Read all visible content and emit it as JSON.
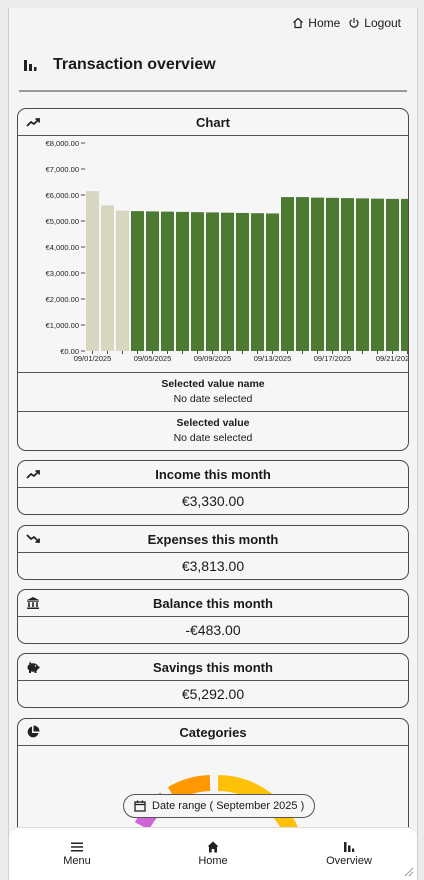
{
  "nav": {
    "home_label": "Home",
    "logout_label": "Logout"
  },
  "page": {
    "title": "Transaction overview"
  },
  "chart_card": {
    "title": "Chart",
    "selected_name_label": "Selected value name",
    "selected_name_value": "No date selected",
    "selected_value_label": "Selected value",
    "selected_value_value": "No date selected"
  },
  "chart_data": {
    "type": "bar",
    "ylim": [
      0,
      8000
    ],
    "yticks": [
      "€0.00",
      "€1,000.00",
      "€2,000.00",
      "€3,000.00",
      "€4,000.00",
      "€5,000.00",
      "€6,000.00",
      "€7,000.00",
      "€8,000.00"
    ],
    "x_tick_labels": [
      "09/01/2025",
      "09/05/2025",
      "09/09/2025",
      "09/13/2025",
      "09/17/2025",
      "09/21/202"
    ],
    "values": [
      6150,
      5600,
      5400,
      5380,
      5370,
      5360,
      5350,
      5340,
      5330,
      5320,
      5310,
      5300,
      5290,
      5920,
      5920,
      5900,
      5890,
      5880,
      5870,
      5860,
      5850,
      5850,
      5840
    ],
    "colors": {
      "past": "#d6d6c1",
      "current": "#4c7a33"
    },
    "past_count": 3
  },
  "cards": [
    {
      "title": "Income this month",
      "value": "€3,330.00",
      "icon": "trending-up-icon"
    },
    {
      "title": "Expenses this month",
      "value": "€3,813.00",
      "icon": "trending-down-icon"
    },
    {
      "title": "Balance this month",
      "value": "-€483.00",
      "icon": "bank-icon"
    },
    {
      "title": "Savings this month",
      "value": "€5,292.00",
      "icon": "piggy-bank-icon"
    }
  ],
  "categories": {
    "title": "Categories",
    "date_range_label": "Date range ( September 2025 )",
    "donut_colors": [
      "#e8602c",
      "#d066d6",
      "#ff9800",
      "#ffc107"
    ]
  },
  "bottom_nav": {
    "menu_label": "Menu",
    "home_label": "Home",
    "overview_label": "Overview"
  }
}
